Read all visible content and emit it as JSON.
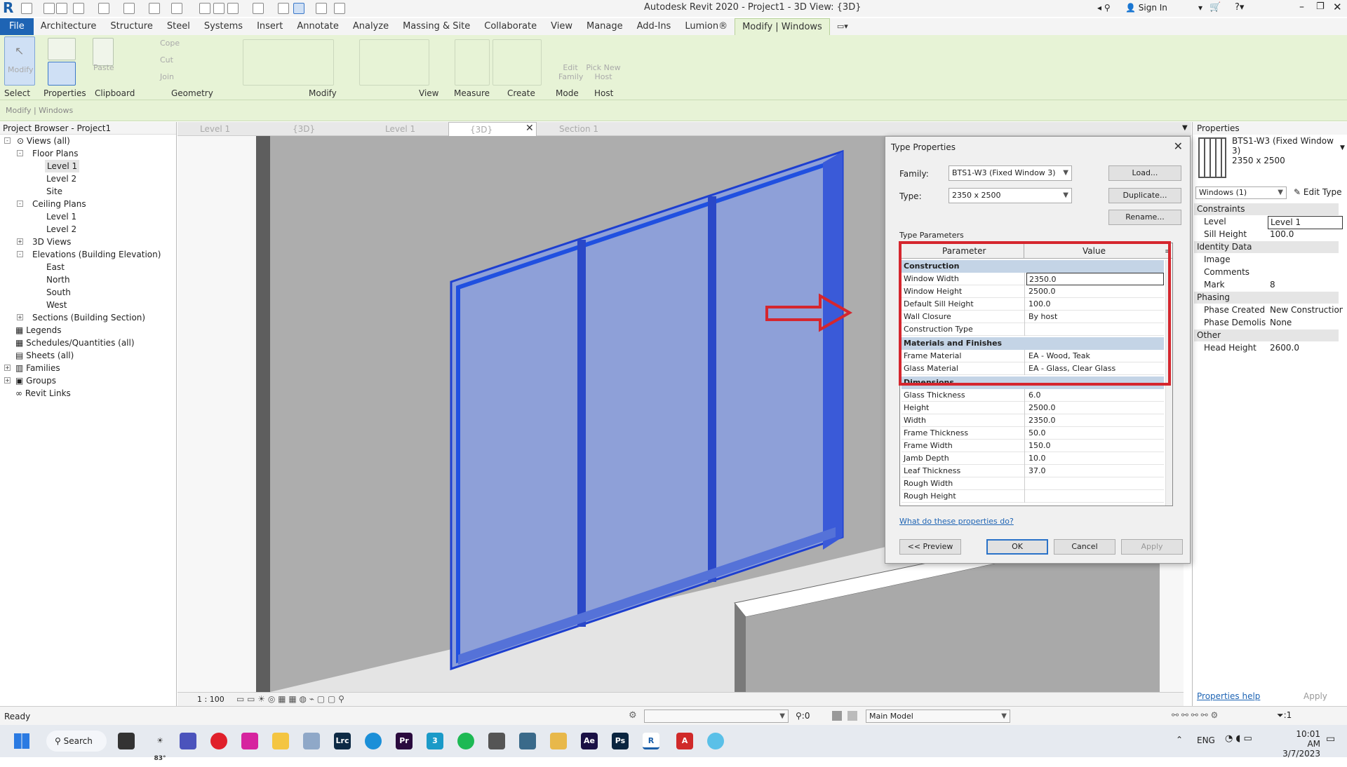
{
  "app": {
    "title": "Autodesk Revit 2020 - Project1 - 3D View: {3D}",
    "sign_in": "Sign In"
  },
  "menu": [
    "File",
    "Architecture",
    "Structure",
    "Steel",
    "Systems",
    "Insert",
    "Annotate",
    "Analyze",
    "Massing & Site",
    "Collaborate",
    "View",
    "Manage",
    "Add-Ins",
    "Lumion®",
    "Modify | Windows"
  ],
  "ribbon": {
    "modify": "Modify",
    "paste": "Paste",
    "cope": "Cope",
    "cut": "Cut",
    "join": "Join",
    "edit_family": "Edit Family",
    "pick_host": "Pick New Host",
    "panels": [
      "Select",
      "Properties",
      "Clipboard",
      "Geometry",
      "Modify",
      "View",
      "Measure",
      "Create",
      "Mode",
      "Host"
    ]
  },
  "context_label": "Modify | Windows",
  "browser": {
    "title": "Project Browser - Project1",
    "items": [
      "Views (all)",
      "Floor Plans",
      "Level 1",
      "Level 2",
      "Site",
      "Ceiling Plans",
      "Level 1",
      "Level 2",
      "3D Views",
      "Elevations (Building Elevation)",
      "East",
      "North",
      "South",
      "West",
      "Sections (Building Section)",
      "Legends",
      "Schedules/Quantities (all)",
      "Sheets (all)",
      "Families",
      "Groups",
      "Revit Links"
    ]
  },
  "tabs": [
    "Level 1",
    "{3D}",
    "Level 1",
    "{3D}",
    "Section 1"
  ],
  "view_scale": "1 : 100",
  "dialog": {
    "title": "Type Properties",
    "family_label": "Family:",
    "family_value": "BTS1-W3 (Fixed Window 3)",
    "type_label": "Type:",
    "type_value": "2350 x 2500",
    "load": "Load...",
    "duplicate": "Duplicate...",
    "rename": "Rename...",
    "type_params": "Type Parameters",
    "col_param": "Parameter",
    "col_value": "Value",
    "sections": [
      "Construction",
      "Materials and Finishes",
      "Dimensions"
    ],
    "construction": [
      [
        "Window Width",
        "2350.0"
      ],
      [
        "Window Height",
        "2500.0"
      ],
      [
        "Default Sill Height",
        "100.0"
      ],
      [
        "Wall Closure",
        "By host"
      ],
      [
        "Construction Type",
        ""
      ]
    ],
    "materials": [
      [
        "Frame Material",
        "EA - Wood, Teak"
      ],
      [
        "Glass Material",
        "EA - Glass, Clear Glass"
      ]
    ],
    "dimensions": [
      [
        "Glass Thickness",
        "6.0"
      ],
      [
        "Height",
        "2500.0"
      ],
      [
        "Width",
        "2350.0"
      ],
      [
        "Frame Thickness",
        "50.0"
      ],
      [
        "Frame Width",
        "150.0"
      ],
      [
        "Jamb Depth",
        "10.0"
      ],
      [
        "Leaf Thickness",
        "37.0"
      ],
      [
        "Rough Width",
        ""
      ],
      [
        "Rough Height",
        ""
      ]
    ],
    "help_link": "What do these properties do?",
    "preview": "<< Preview",
    "ok": "OK",
    "cancel": "Cancel",
    "apply": "Apply"
  },
  "properties": {
    "title": "Properties",
    "type_name": "BTS1-W3 (Fixed Window 3)",
    "type_size": "2350 x 2500",
    "selector": "Windows (1)",
    "edit_type": "Edit Type",
    "groups": [
      {
        "name": "Constraints",
        "rows": [
          [
            "Level",
            "Level 1"
          ],
          [
            "Sill Height",
            "100.0"
          ]
        ]
      },
      {
        "name": "Identity Data",
        "rows": [
          [
            "Image",
            ""
          ],
          [
            "Comments",
            ""
          ],
          [
            "Mark",
            "8"
          ]
        ]
      },
      {
        "name": "Phasing",
        "rows": [
          [
            "Phase Created",
            "New Construction"
          ],
          [
            "Phase Demolish...",
            "None"
          ]
        ]
      },
      {
        "name": "Other",
        "rows": [
          [
            "Head Height",
            "2600.0"
          ]
        ]
      }
    ],
    "help": "Properties help",
    "apply": "Apply"
  },
  "status": {
    "ready": "Ready",
    "zero": ":0",
    "model": "Main Model",
    "filter": ":1"
  },
  "taskbar": {
    "search": "Search",
    "temp": "83°",
    "lang": "ENG",
    "time": "10:01 AM",
    "date": "3/7/2023"
  },
  "colors": {
    "accent": "#1e64b4",
    "ribbon": "#e7f3d6",
    "highlight": "#d5262e",
    "window_blue": "#2a4fd6"
  }
}
